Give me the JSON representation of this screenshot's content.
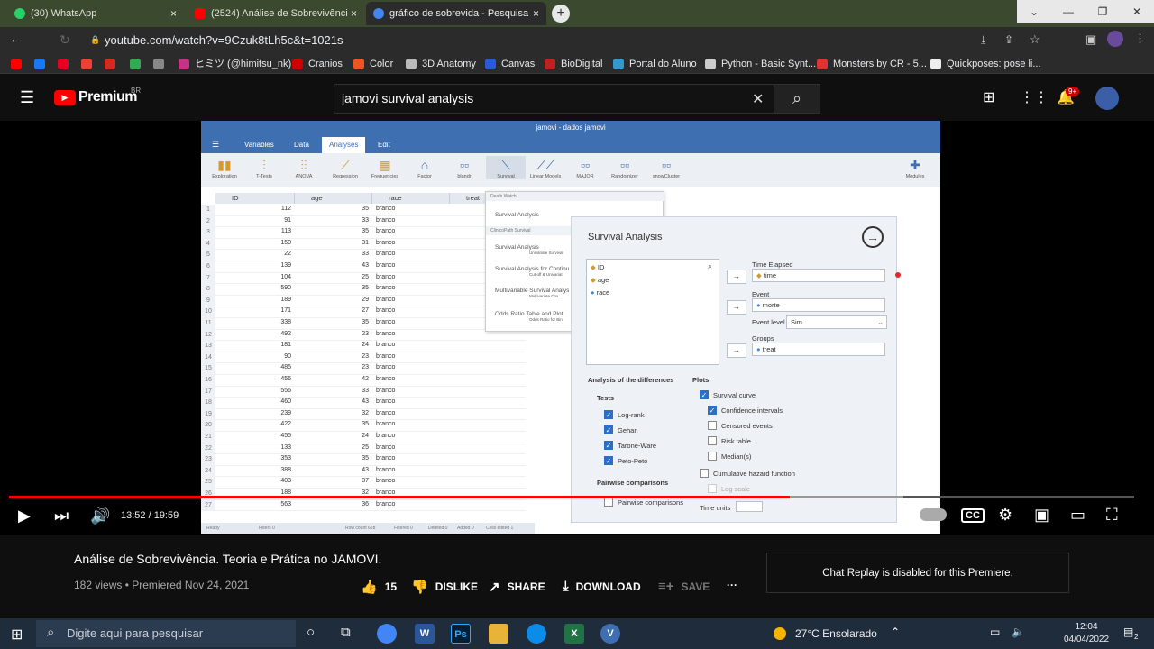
{
  "browser": {
    "tabs": [
      {
        "label": "(30) WhatsApp",
        "icon": "whatsapp-icon",
        "color": "#25d366"
      },
      {
        "label": "(2524) Análise de Sobrevivência.",
        "icon": "youtube-icon",
        "color": "#ff0000"
      },
      {
        "label": "gráfico de sobrevida - Pesquisa",
        "icon": "google-icon",
        "color": "#4285f4"
      }
    ],
    "close_glyph": "×",
    "new_tab_glyph": "+",
    "url": "youtube.com/watch?v=9Czuk8tLh5c&t=1021s",
    "bookmarks": [
      {
        "label": "",
        "color": "#f00"
      },
      {
        "label": "",
        "color": "#1877f2"
      },
      {
        "label": "",
        "color": "#e60023"
      },
      {
        "label": "",
        "color": "#ea4335"
      },
      {
        "label": "",
        "color": "#d52b1e"
      },
      {
        "label": "",
        "color": "#34a853"
      },
      {
        "label": "",
        "color": "#888"
      },
      {
        "label": "ヒミツ (@himitsu_nk)...",
        "color": "#c13584"
      },
      {
        "label": "Cranios",
        "color": "#c00"
      },
      {
        "label": "Color",
        "color": "#e52"
      },
      {
        "label": "3D Anatomy",
        "color": "#bbb"
      },
      {
        "label": "Canvas",
        "color": "#2a5bd7"
      },
      {
        "label": "BioDigital",
        "color": "#b22"
      },
      {
        "label": "Portal do Aluno",
        "color": "#39c"
      },
      {
        "label": "Python - Basic Synt...",
        "color": "#ccc"
      },
      {
        "label": "Monsters by CR - 5...",
        "color": "#d33"
      },
      {
        "label": "Quickposes: pose li...",
        "color": "#eee"
      }
    ]
  },
  "youtube": {
    "logo_text": "Premium",
    "logo_region": "BR",
    "search_value": "jamovi survival analysis",
    "notif_count": "9+",
    "time": "13:52 / 19:59",
    "progress": 0.694,
    "buffered": 0.795,
    "title": "Análise de Sobrevivência. Teoria e Prática no JAMOVI.",
    "meta": "182 views • Premiered Nov 24, 2021",
    "likes": "15",
    "dislike": "DISLIKE",
    "share": "SHARE",
    "download": "DOWNLOAD",
    "save": "SAVE",
    "more": "···",
    "chat": "Chat Replay is disabled for this Premiere."
  },
  "jamovi": {
    "title": "jamovi - dados jamovi",
    "menu": [
      "Variables",
      "Data",
      "Analyses",
      "Edit"
    ],
    "tools": [
      "Exploration",
      "T-Tests",
      "ANOVA",
      "Regression",
      "Frequencies",
      "Factor",
      "blandr",
      "Survival",
      "Linear Models",
      "MAJOR",
      "Randomizer",
      "snowCluster"
    ],
    "modules": "Modules",
    "columns": [
      "ID",
      "age",
      "race",
      "treat"
    ],
    "rows": [
      [
        "1",
        "112",
        "35",
        "branco"
      ],
      [
        "2",
        "91",
        "33",
        "branco"
      ],
      [
        "3",
        "113",
        "35",
        "branco"
      ],
      [
        "4",
        "150",
        "31",
        "branco"
      ],
      [
        "5",
        "22",
        "33",
        "branco"
      ],
      [
        "6",
        "139",
        "43",
        "branco"
      ],
      [
        "7",
        "104",
        "25",
        "branco"
      ],
      [
        "8",
        "590",
        "35",
        "branco"
      ],
      [
        "9",
        "189",
        "29",
        "branco"
      ],
      [
        "10",
        "171",
        "27",
        "branco"
      ],
      [
        "11",
        "338",
        "35",
        "branco"
      ],
      [
        "12",
        "492",
        "23",
        "branco"
      ],
      [
        "13",
        "181",
        "24",
        "branco"
      ],
      [
        "14",
        "90",
        "23",
        "branco"
      ],
      [
        "15",
        "485",
        "23",
        "branco"
      ],
      [
        "16",
        "456",
        "42",
        "branco"
      ],
      [
        "17",
        "556",
        "33",
        "branco"
      ],
      [
        "18",
        "460",
        "43",
        "branco"
      ],
      [
        "19",
        "239",
        "32",
        "branco"
      ],
      [
        "20",
        "422",
        "35",
        "branco"
      ],
      [
        "21",
        "455",
        "24",
        "branco"
      ],
      [
        "22",
        "133",
        "25",
        "branco"
      ],
      [
        "23",
        "353",
        "35",
        "branco"
      ],
      [
        "24",
        "388",
        "43",
        "branco"
      ],
      [
        "25",
        "403",
        "37",
        "branco"
      ],
      [
        "26",
        "188",
        "32",
        "branco"
      ],
      [
        "27",
        "563",
        "36",
        "branco"
      ]
    ],
    "status": [
      "Ready",
      "Filters 0",
      "Row count 628",
      "Filtered 0",
      "Deleted 0",
      "Added 0",
      "Cells edited 1"
    ],
    "dropdown": {
      "h1": "Death Watch",
      "i1": "Survival Analysis",
      "h2": "ClinicoPath Survival",
      "i2": "Survival Analysis",
      "i2s": "Univariate Survival",
      "i3": "Survival Analysis for Continu",
      "i3s": "Cut-off & Univariat",
      "i4": "Multivariable Survival Analys",
      "i4s": "Multivariate Cox",
      "i5": "Odds Ratio Table and Plot",
      "i5s": "Odds Ratio for Bin"
    },
    "panel": {
      "title": "Survival Analysis",
      "vars": [
        "ID",
        "age",
        "race"
      ],
      "time_label": "Time Elapsed",
      "time_value": "time",
      "event_label": "Event",
      "event_value": "morte",
      "event_level_label": "Event level",
      "event_level_value": "Sim",
      "groups_label": "Groups",
      "groups_value": "treat",
      "diff_label": "Analysis of the differences",
      "tests_label": "Tests",
      "tests": [
        "Log-rank",
        "Gehan",
        "Tarone-Ware",
        "Peto-Peto"
      ],
      "pairwise_label": "Pairwise comparisons",
      "pairwise_item": "Pairwise comparisons",
      "plots_label": "Plots",
      "survival_curve": "Survival curve",
      "confidence": "Confidence intervals",
      "censored": "Censored events",
      "risk": "Risk table",
      "medians": "Median(s)",
      "cumhaz": "Cumulative hazard function",
      "logscale": "Log scale",
      "timeunits": "Time units"
    }
  },
  "taskbar": {
    "search_placeholder": "Digite aqui para pesquisar",
    "weather": "27°C  Ensolarado",
    "time": "12:04",
    "date": "04/04/2022",
    "notif": "2"
  }
}
